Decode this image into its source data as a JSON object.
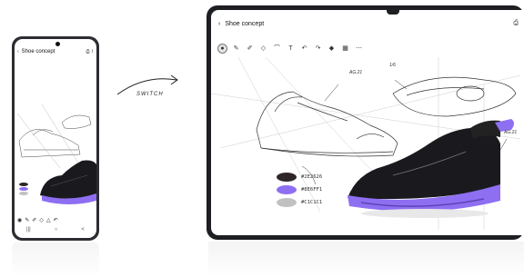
{
  "phone": {
    "title": "Shoe concept",
    "back_icon": "chevron-left-icon",
    "toolbar_icons": [
      "select-icon",
      "pen-icon",
      "brush-icon",
      "eraser-icon",
      "lasso-icon",
      "undo-icon"
    ],
    "nav": [
      "|||",
      "○",
      "<"
    ]
  },
  "transition": {
    "label": "SWITCH"
  },
  "tablet": {
    "title": "Shoe concept",
    "back_icon": "chevron-left-icon",
    "toolbar_icons": [
      "select-icon",
      "pen-icon",
      "pencil-icon",
      "eraser-icon",
      "lasso-icon",
      "text-icon",
      "undo-icon",
      "redo-icon",
      "shape-icon",
      "grid-icon",
      "ruler-icon",
      "more-icon"
    ],
    "annotations": [
      "AG.21",
      "1/6",
      "AG.21"
    ],
    "palette": [
      {
        "hex": "#2E2626",
        "color": "#2e2626"
      },
      {
        "hex": "#8E6FF1",
        "color": "#8e6ff1"
      },
      {
        "hex": "#C1C1C1",
        "color": "#c1c1c1"
      }
    ]
  },
  "colors": {
    "accent": "#8e6ff1",
    "bezel": "#1d1f23",
    "shoe_dark": "#1a1a1e"
  }
}
